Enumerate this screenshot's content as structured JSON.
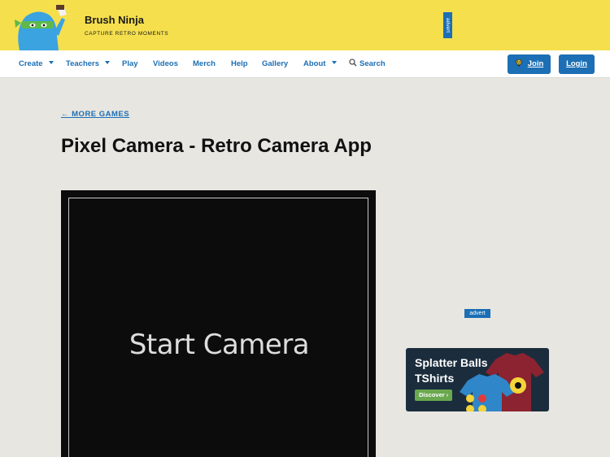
{
  "header": {
    "brand": "Brush Ninja",
    "tagline": "CAPTURE RETRO MOMENTS",
    "advert": "advert"
  },
  "nav": {
    "items": [
      "Create",
      "Teachers",
      "Play",
      "Videos",
      "Merch",
      "Help",
      "Gallery",
      "About"
    ],
    "search": "Search",
    "join": "Join",
    "login": "Login"
  },
  "main": {
    "back_link": "← MORE GAMES",
    "title": "Pixel Camera - Retro Camera App",
    "start_camera": "Start Camera"
  },
  "sidebar": {
    "advert": "advert",
    "ad_line1": "Splatter Balls",
    "ad_line2": "TShirts",
    "ad_cta": "Discover ›"
  },
  "colors": {
    "header_bg": "#f5df4d",
    "accent": "#1c6fb4",
    "page_bg": "#e7e6e1"
  }
}
